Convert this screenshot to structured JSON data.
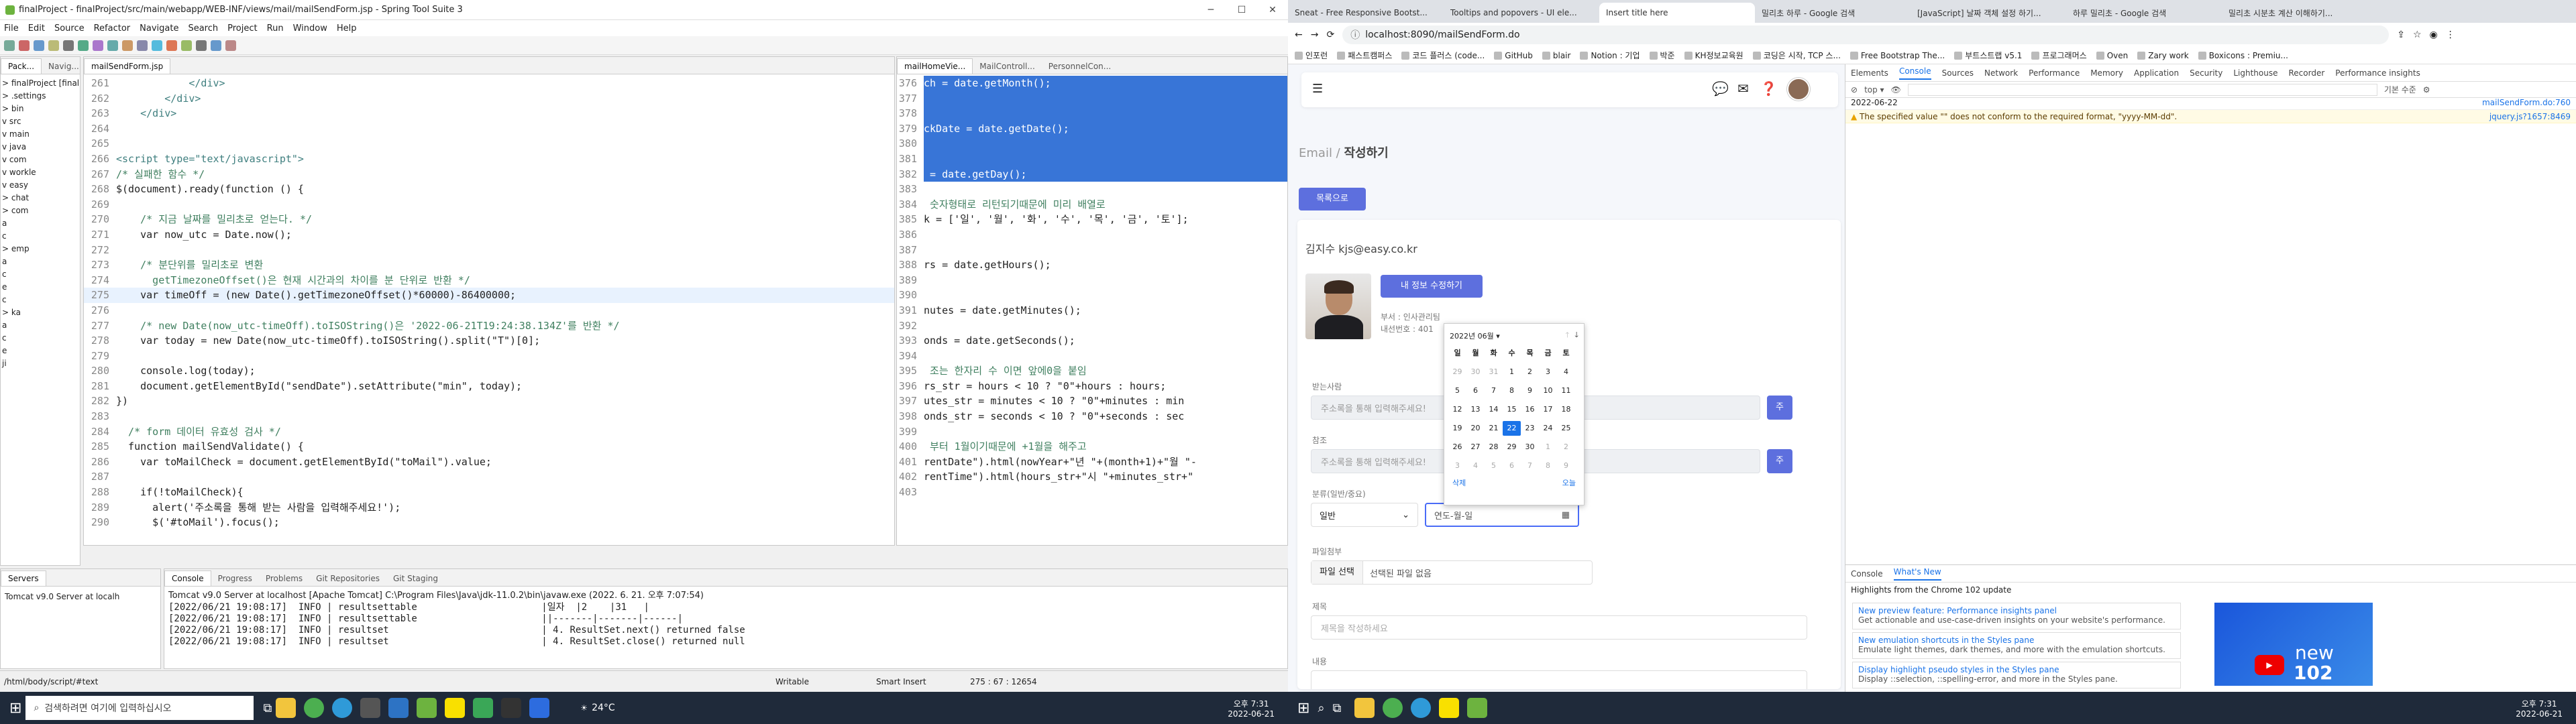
{
  "eclipse": {
    "title": "finalProject - finalProject/src/main/webapp/WEB-INF/views/mail/mailSendForm.jsp - Spring Tool Suite 3",
    "menu": [
      "File",
      "Edit",
      "Source",
      "Refactor",
      "Navigate",
      "Search",
      "Project",
      "Run",
      "Window",
      "Help"
    ],
    "explorer": {
      "tabs": [
        "Pack...",
        "Navig..."
      ],
      "tree": [
        "> finalProject [finalProject]",
        "  > .settings",
        "  > bin",
        "  v src",
        "    v main",
        "      v java",
        "        v com",
        "          v workle",
        "            v easy",
        "              > chat",
        "              > com",
        "                a",
        "                c",
        "              > emp",
        "                a",
        "                c",
        "                e",
        "                c",
        "              > ka",
        "                a",
        "                c",
        "                e",
        "                ji"
      ]
    },
    "editor_tabs": [
      "mailSendForm.jsp"
    ],
    "code_lines": [
      {
        "n": "261",
        "t": "            </div>",
        "c": "tag"
      },
      {
        "n": "262",
        "t": "        </div>",
        "c": "tag"
      },
      {
        "n": "263",
        "t": "    </div>",
        "c": "tag"
      },
      {
        "n": "264",
        "t": "",
        "c": "p"
      },
      {
        "n": "265",
        "t": "",
        "c": "p"
      },
      {
        "n": "266",
        "t": "<script type=\"text/javascript\">",
        "c": "tag"
      },
      {
        "n": "267",
        "t": "/* 실패한 함수 */",
        "c": "cm"
      },
      {
        "n": "268",
        "t": "$(document).ready(function () {",
        "c": "p"
      },
      {
        "n": "269",
        "t": "",
        "c": "p"
      },
      {
        "n": "270",
        "t": "    /* 지금 날짜를 밀리초로 얻는다. */",
        "c": "cm"
      },
      {
        "n": "271",
        "t": "    var now_utc = Date.now();",
        "c": "p"
      },
      {
        "n": "272",
        "t": "",
        "c": "p"
      },
      {
        "n": "273",
        "t": "    /* 분단위를 밀리초로 변환",
        "c": "cm"
      },
      {
        "n": "274",
        "t": "      getTimezoneOffset()은 현재 시간과의 차이를 분 단위로 반환 */",
        "c": "cm"
      },
      {
        "n": "275",
        "t": "    var timeOff = (new Date().getTimezoneOffset()*60000)-86400000;",
        "c": "p"
      },
      {
        "n": "276",
        "t": "",
        "c": "p"
      },
      {
        "n": "277",
        "t": "    /* new Date(now_utc-timeOff).toISOString()은 '2022-06-21T19:24:38.134Z'를 반환 */",
        "c": "cm"
      },
      {
        "n": "278",
        "t": "    var today = new Date(now_utc-timeOff).toISOString().split(\"T\")[0];",
        "c": "p"
      },
      {
        "n": "279",
        "t": "",
        "c": "p"
      },
      {
        "n": "280",
        "t": "    console.log(today);",
        "c": "p"
      },
      {
        "n": "281",
        "t": "    document.getElementById(\"sendDate\").setAttribute(\"min\", today);",
        "c": "p"
      },
      {
        "n": "282",
        "t": "})",
        "c": "p"
      },
      {
        "n": "283",
        "t": "",
        "c": "p"
      },
      {
        "n": "284",
        "t": "  /* form 데이터 유효성 검사 */",
        "c": "cm"
      },
      {
        "n": "285",
        "t": "  function mailSendValidate() {",
        "c": "p"
      },
      {
        "n": "286",
        "t": "    var toMailCheck = document.getElementById(\"toMail\").value;",
        "c": "p"
      },
      {
        "n": "287",
        "t": "",
        "c": "p"
      },
      {
        "n": "288",
        "t": "    if(!toMailCheck){",
        "c": "p"
      },
      {
        "n": "289",
        "t": "      alert('주소록을 통해 받는 사람을 입력해주세요!');",
        "c": "p"
      },
      {
        "n": "290",
        "t": "      $('#toMail').focus();",
        "c": "p"
      }
    ],
    "editor2_tabs": [
      "mailHomeVie...",
      "MailControll...",
      "PersonnelCon..."
    ],
    "code2_lines": [
      {
        "n": "376",
        "t": "ch = date.getMonth();",
        "s": true
      },
      {
        "n": "377",
        "t": "",
        "s": true
      },
      {
        "n": "378",
        "t": "",
        "s": true
      },
      {
        "n": "379",
        "t": "ckDate = date.getDate();",
        "s": true
      },
      {
        "n": "380",
        "t": "",
        "s": true
      },
      {
        "n": "381",
        "t": "",
        "s": true
      },
      {
        "n": "382",
        "t": " = date.getDay();",
        "s": true
      },
      {
        "n": "383",
        "t": "",
        "s": false
      },
      {
        "n": "384",
        "t": " 숫자형태로 리턴되기때문에 미리 배열로",
        "s": false
      },
      {
        "n": "385",
        "t": "k = ['일', '월', '화', '수', '목', '금', '토'];",
        "s": false
      },
      {
        "n": "386",
        "t": "",
        "s": false
      },
      {
        "n": "387",
        "t": "",
        "s": false
      },
      {
        "n": "388",
        "t": "rs = date.getHours();",
        "s": false
      },
      {
        "n": "389",
        "t": "",
        "s": false
      },
      {
        "n": "390",
        "t": "",
        "s": false
      },
      {
        "n": "391",
        "t": "nutes = date.getMinutes();",
        "s": false
      },
      {
        "n": "392",
        "t": "",
        "s": false
      },
      {
        "n": "393",
        "t": "onds = date.getSeconds();",
        "s": false
      },
      {
        "n": "394",
        "t": "",
        "s": false
      },
      {
        "n": "395",
        "t": " 조는 한자리 수 이면 앞에0을 붙임",
        "s": false
      },
      {
        "n": "396",
        "t": "rs_str = hours < 10 ? \"0\"+hours : hours;",
        "s": false
      },
      {
        "n": "397",
        "t": "utes_str = minutes < 10 ? \"0\"+minutes : min",
        "s": false
      },
      {
        "n": "398",
        "t": "onds_str = seconds < 10 ? \"0\"+seconds : sec",
        "s": false
      },
      {
        "n": "399",
        "t": "",
        "s": false
      },
      {
        "n": "400",
        "t": " 부터 1월이기때문에 +1월을 해주고",
        "s": false
      },
      {
        "n": "401",
        "t": "rentDate\").html(nowYear+\"년 \"+(month+1)+\"월 \"-",
        "s": false
      },
      {
        "n": "402",
        "t": "rentTime\").html(hours_str+\"시 \"+minutes_str+\"",
        "s": false
      },
      {
        "n": "403",
        "t": "",
        "s": false
      }
    ],
    "servers_tab": "Servers",
    "server_item": "Tomcat v9.0 Server at localh",
    "console_tabs": [
      "Console",
      "Progress",
      "Problems",
      "Git Repositories",
      "Git Staging"
    ],
    "console_header": "Tomcat v9.0 Server at localhost [Apache Tomcat] C:\\Program Files\\Java\\jdk-11.0.2\\bin\\javaw.exe  (2022. 6. 21. 오후 7:07:54)",
    "console_lines": [
      "[2022/06/21 19:08:17]  INFO | resultsettable                      |일자  |2    |31   |",
      "[2022/06/21 19:08:17]  INFO | resultsettable                      ||-------|-------|------|",
      "[2022/06/21 19:08:17]  INFO | resultset                           | 4. ResultSet.next() returned false",
      "[2022/06/21 19:08:17]  INFO | resultset                           | 4. ResultSet.close() returned null"
    ],
    "status": {
      "path": "/html/body/script/#text",
      "mode1": "Writable",
      "mode2": "Smart Insert",
      "pos": "275 : 67 : 12654"
    }
  },
  "taskbar": {
    "search_placeholder": "검색하려면 여기에 입력하십시오",
    "weather": "24°C",
    "time1": "오후 7:31",
    "date1": "2022-06-21",
    "time2": "오후 7:31",
    "date2": "2022-06-21"
  },
  "chrome": {
    "tabs": [
      "Sneat - Free Responsive Bootst...",
      "Tooltips and popovers - UI ele...",
      "Insert title here",
      "밀리초 하루 - Google 검색",
      "[JavaScript] 날짜 객체 설정 하기...",
      "하루 밀리초 - Google 검색",
      "밀리초 시분초 계산 이해하기..."
    ],
    "url": "localhost:8090/mailSendForm.do",
    "bookmarks": [
      "인포런",
      "패스트캠퍼스",
      "코드 플러스 (code...",
      "GitHub",
      "blair",
      "Notion : 기업",
      "박준",
      "KH정보교육원",
      "코딩은 시작, TCP 스...",
      "Free Bootstrap The...",
      "부트스트랩 v5.1",
      "프로그래머스",
      "Oven",
      "Zary work",
      "Boxicons : Premiu..."
    ],
    "page": {
      "breadcrumb_prefix": "Email /",
      "breadcrumb_title": "작성하기",
      "list_button": "목록으로",
      "sender": "김지수 kjs@easy.co.kr",
      "edit_button": "내 정보 수정하기",
      "info1": "부서 : 인사관리팀",
      "info2": "내선번호 : 401",
      "to_label": "받는사람",
      "to_placeholder": "주소록을 통해 입력해주세요!",
      "to_btn": "주",
      "cc_label": "참조",
      "cc_placeholder": "주소록을 통해 입력해주세요!",
      "cc_btn": "주",
      "type_label": "분류(일반/중요)",
      "type_value": "일반",
      "date_value": "연도-월-일",
      "file_label": "파일첨부",
      "file_button": "파일 선택",
      "file_text": "선택된 파일 없음",
      "subject_label": "제목",
      "subject_placeholder": "제목을 작성하세요",
      "content_label": "내용",
      "calendar": {
        "month": "2022년 06월",
        "days": [
          "일",
          "월",
          "화",
          "수",
          "목",
          "금",
          "토"
        ],
        "weeks": [
          [
            "29",
            "30",
            "31",
            "1",
            "2",
            "3",
            "4"
          ],
          [
            "5",
            "6",
            "7",
            "8",
            "9",
            "10",
            "11"
          ],
          [
            "12",
            "13",
            "14",
            "15",
            "16",
            "17",
            "18"
          ],
          [
            "19",
            "20",
            "21",
            "22",
            "23",
            "24",
            "25"
          ],
          [
            "26",
            "27",
            "28",
            "29",
            "30",
            "1",
            "2"
          ],
          [
            "3",
            "4",
            "5",
            "6",
            "7",
            "8",
            "9"
          ]
        ],
        "delete": "삭제",
        "today": "오늘"
      }
    },
    "devtools": {
      "tabs": [
        "Elements",
        "Console",
        "Sources",
        "Network",
        "Performance",
        "Memory",
        "Application",
        "Security",
        "Lighthouse",
        "Recorder",
        "Performance insights"
      ],
      "active_tab": "Console",
      "filter_level": "기본 수준",
      "log1": "2022-06-22",
      "log1_src": "mailSendForm.do:760",
      "warn": "The specified value \"\" does not conform to the required format, \"yyyy-MM-dd\".",
      "warn_src": "jquery.js?1657:8469",
      "drawer_tabs": [
        "Console",
        "What's New"
      ],
      "whatsnew_title": "Highlights from the Chrome 102 update",
      "news": [
        {
          "title": "New preview feature: Performance insights panel",
          "desc": "Get actionable and use-case-driven insights on your website's performance."
        },
        {
          "title": "New emulation shortcuts in the Styles pane",
          "desc": "Emulate light themes, dark themes, and more with the emulation shortcuts."
        },
        {
          "title": "Display highlight pseudo styles in the Styles pane",
          "desc": "Display ::selection, ::spelling-error, and more in the Styles pane."
        }
      ],
      "video_label": "new",
      "video_num": "102"
    }
  }
}
